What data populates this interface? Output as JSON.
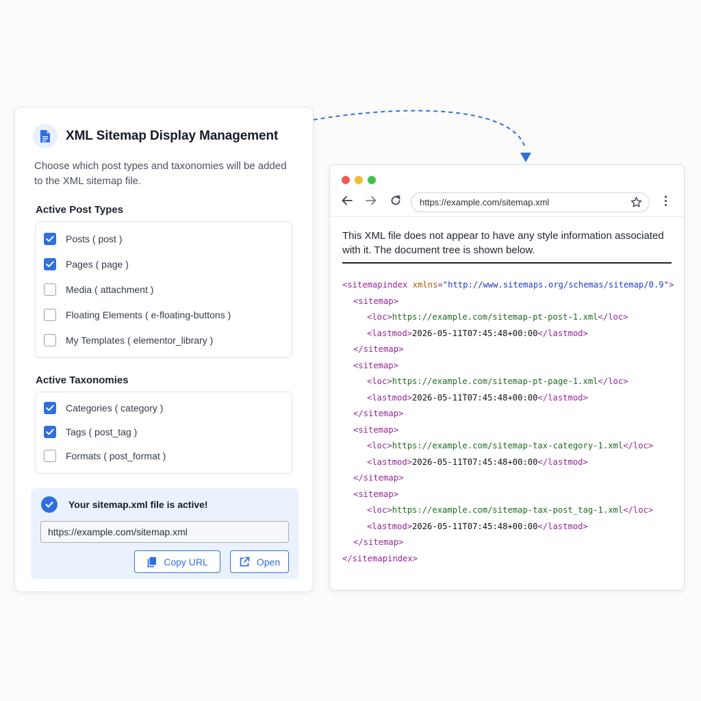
{
  "panel": {
    "title": "XML Sitemap Display Management",
    "description": "Choose which post types and taxonomies will be added to the XML sitemap file.",
    "post_types_label": "Active Post Types",
    "post_types": [
      {
        "label": "Posts",
        "slug": "post",
        "checked": true
      },
      {
        "label": "Pages",
        "slug": "page",
        "checked": true
      },
      {
        "label": "Media",
        "slug": "attachment",
        "checked": false
      },
      {
        "label": "Floating Elements",
        "slug": "e-floating-buttons",
        "checked": false
      },
      {
        "label": "My Templates",
        "slug": "elementor_library",
        "checked": false
      }
    ],
    "taxonomies_label": "Active Taxonomies",
    "taxonomies": [
      {
        "label": "Categories",
        "slug": "category",
        "checked": true
      },
      {
        "label": "Tags",
        "slug": "post_tag",
        "checked": true
      },
      {
        "label": "Formats",
        "slug": "post_format",
        "checked": false
      }
    ],
    "status": {
      "message": "Your sitemap.xml file is active!",
      "url": "https://example.com/sitemap.xml",
      "copy_label": "Copy URL",
      "open_label": "Open"
    }
  },
  "browser": {
    "address": "https://example.com/sitemap.xml",
    "note": "This XML file does not appear to have any style information associated with it. The document tree is shown below.",
    "root_open": "<sitemapindex",
    "root_attr": "xmlns",
    "root_attr_value": "\"http://www.sitemaps.org/schemas/sitemap/0.9\"",
    "root_open_end": ">",
    "root_close": "</sitemapindex>",
    "sitemap_open": "<sitemap>",
    "sitemap_close": "</sitemap>",
    "loc_open": "<loc>",
    "loc_close": "</loc>",
    "lastmod_open": "<lastmod>",
    "lastmod_close": "</lastmod>",
    "entries": [
      {
        "loc": "https://example.com/sitemap-pt-post-1.xml",
        "lastmod": "2026-05-11T07:45:48+00:00"
      },
      {
        "loc": "https://example.com/sitemap-pt-page-1.xml",
        "lastmod": "2026-05-11T07:45:48+00:00"
      },
      {
        "loc": "https://example.com/sitemap-tax-category-1.xml",
        "lastmod": "2026-05-11T07:45:48+00:00"
      },
      {
        "loc": "https://example.com/sitemap-tax-post_tag-1.xml",
        "lastmod": "2026-05-11T07:45:48+00:00"
      }
    ]
  },
  "colors": {
    "accent": "#2f6fe0",
    "status_bg": "#eaf2fd",
    "traffic_red": "#ed5b53",
    "traffic_yellow": "#f4bd2f",
    "traffic_green": "#3fc14a"
  },
  "icons": {
    "header": "document-icon",
    "copy": "copy-icon",
    "open": "external-link-icon",
    "status": "check-circle-icon",
    "back": "arrow-left-icon",
    "forward": "arrow-right-icon",
    "reload": "reload-icon",
    "bookmark": "star-icon",
    "menu": "kebab-menu-icon"
  }
}
